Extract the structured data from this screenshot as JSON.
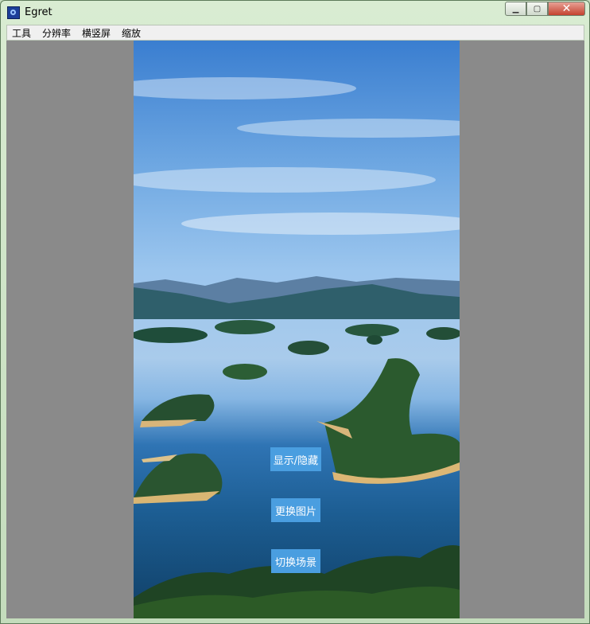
{
  "window": {
    "title": "Egret",
    "controls": {
      "minimize": "▁",
      "maximize": "▢",
      "close": "✕"
    }
  },
  "menu": [
    "工具",
    "分辨率",
    "横竖屏",
    "缩放"
  ],
  "stage": {
    "background_image": "lake-islands-landscape",
    "buttons": {
      "toggle": "显示/隐藏",
      "change_image": "更换图片",
      "switch_scene": "切换场景"
    }
  },
  "colors": {
    "client_background": "#8a8a8a",
    "button_background": "#4a9ee0",
    "button_text": "#ffffff"
  }
}
